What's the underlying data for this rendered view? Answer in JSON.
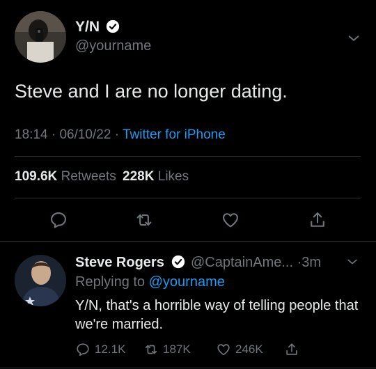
{
  "tweet": {
    "display_name": "Y/N",
    "handle": "@yourname",
    "text": "Steve and I are no longer dating.",
    "time": "18:14",
    "date": "06/10/22",
    "source": "Twitter for iPhone",
    "retweets_count": "109.6K",
    "retweets_label": "Retweets",
    "likes_count": "228K",
    "likes_label": "Likes"
  },
  "reply": {
    "display_name": "Steve Rogers",
    "handle": "@CaptainAme...",
    "time_ago": "3m",
    "replying_prefix": "Replying to",
    "replying_to": "@yourname",
    "text": "Y/N, that's a horrible way of telling people that we're married.",
    "reply_count": "12.1K",
    "retweet_count": "187K",
    "like_count": "246K"
  },
  "colors": {
    "background": "#000000",
    "text": "#e7e9ea",
    "secondary": "#71767b",
    "link": "#1d9bf0",
    "divider": "#2f3336"
  },
  "icons": [
    "verified-badge-icon",
    "chevron-down-icon",
    "reply-icon",
    "retweet-icon",
    "like-icon",
    "share-icon"
  ]
}
